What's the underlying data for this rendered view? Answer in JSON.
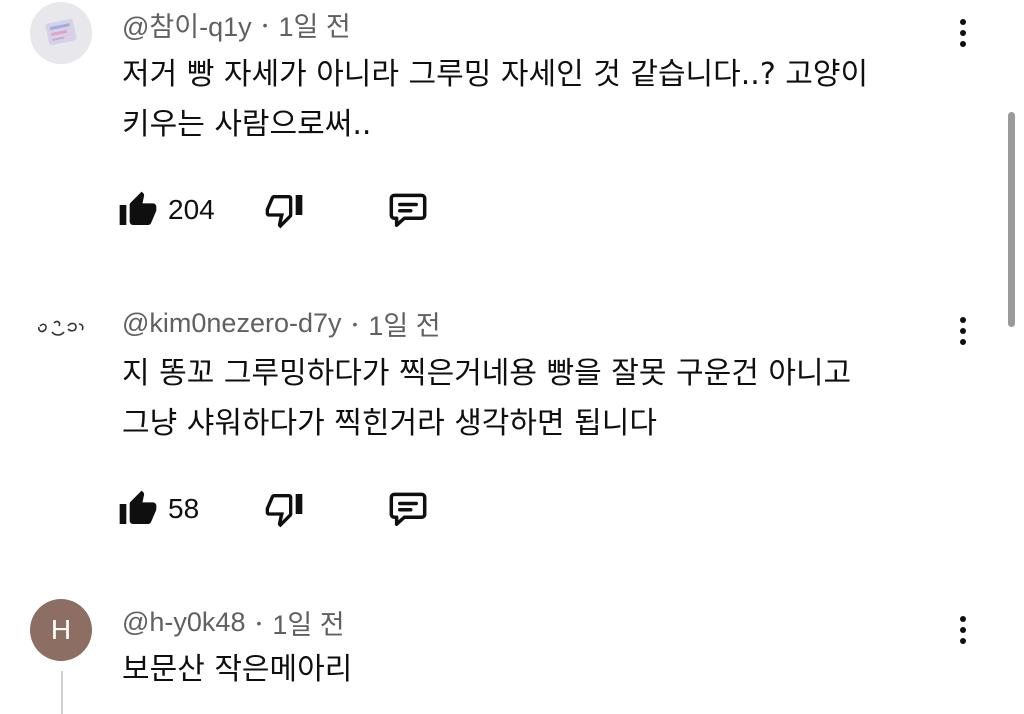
{
  "comments": [
    {
      "handle": "@참이-q1y",
      "time": "1일 전",
      "text_lines": [
        "저거 빵 자세가 아니라 그루밍 자세인 것 같습니다..? 고양이",
        "키우는 사람으로써.."
      ],
      "likes": "204",
      "avatar_icon": "photo-avatar"
    },
    {
      "handle": "@kim0nezero-d7y",
      "time": "1일 전",
      "text_lines": [
        "지 똥꼬 그루밍하다가 찍은거네용 빵을 잘못 구운건 아니고",
        "그냥 샤워하다가 찍힌거라 생각하면 됩니다"
      ],
      "likes": "58",
      "avatar_icon": "sketch-face-avatar"
    },
    {
      "handle": "@h-y0k48",
      "time": "1일 전",
      "text_lines": [
        "보문산 작은메아리"
      ],
      "avatar_letter": "H",
      "avatar_color": "#8d6e63"
    }
  ],
  "icons": {
    "like": "thumbs-up-icon",
    "dislike": "thumbs-down-icon",
    "reply": "reply-comment-icon",
    "menu": "more-vert-icon"
  },
  "separator": "•"
}
